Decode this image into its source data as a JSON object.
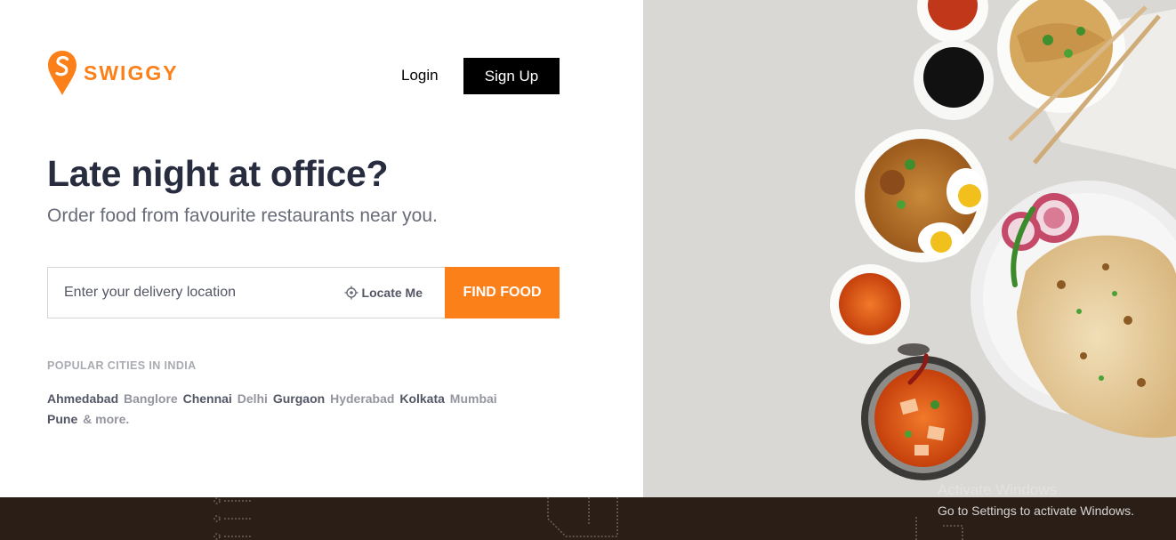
{
  "brand": {
    "name": "SWIGGY",
    "accent": "#fc8019"
  },
  "header": {
    "login_label": "Login",
    "signup_label": "Sign Up"
  },
  "hero": {
    "title": "Late night at office?",
    "subtitle": "Order food from favourite restaurants near you."
  },
  "search": {
    "placeholder": "Enter your delivery location",
    "locate_label": "Locate Me",
    "locate_icon": "crosshair-icon",
    "submit_label": "FIND FOOD"
  },
  "popular": {
    "heading": "POPULAR CITIES IN INDIA",
    "cities": [
      "Ahmedabad",
      "Banglore",
      "Chennai",
      "Delhi",
      "Gurgaon",
      "Hyderabad",
      "Kolkata",
      "Mumbai",
      "Pune"
    ],
    "more_label": "& more."
  },
  "system": {
    "watermark_title": "Activate Windows",
    "watermark_text": "Go to Settings to activate Windows."
  }
}
